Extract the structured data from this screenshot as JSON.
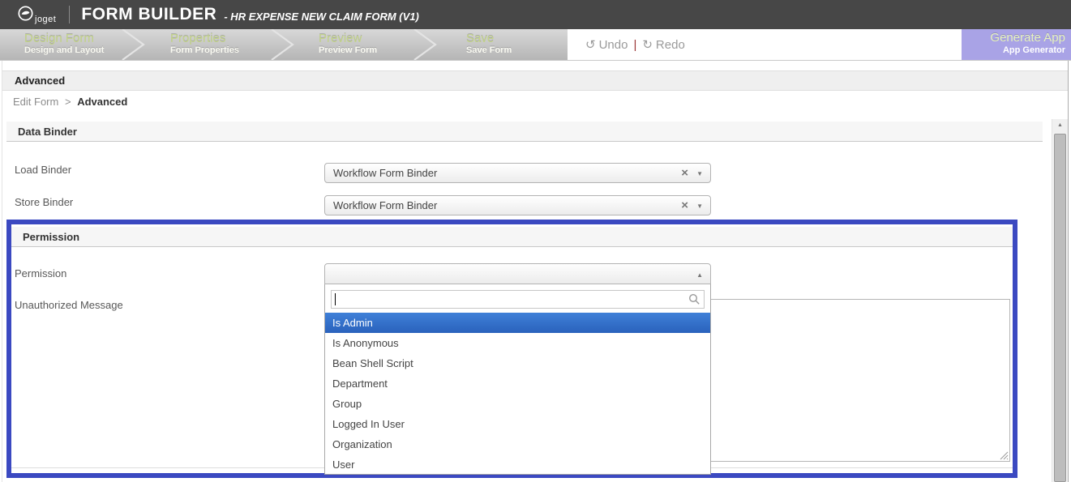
{
  "header": {
    "logo": "joget",
    "title": "FORM BUILDER",
    "subtitle": "- HR EXPENSE NEW CLAIM FORM (V1)"
  },
  "nav": {
    "steps": [
      {
        "label": "Design Form",
        "sublabel": "Design and Layout"
      },
      {
        "label": "Properties",
        "sublabel": "Form Properties"
      },
      {
        "label": "Preview",
        "sublabel": "Preview Form"
      },
      {
        "label": "Save",
        "sublabel": "Save Form"
      }
    ],
    "undo_label": "Undo",
    "redo_label": "Redo",
    "divider": "|",
    "generate_app": {
      "label": "Generate App",
      "sublabel": "App Generator"
    }
  },
  "page": {
    "title": "Advanced",
    "breadcrumb": {
      "parent": "Edit Form",
      "separator": ">",
      "current": "Advanced"
    }
  },
  "data_binder": {
    "title": "Data Binder",
    "fields": [
      {
        "label": "Load Binder",
        "value": "Workflow Form Binder"
      },
      {
        "label": "Store Binder",
        "value": "Workflow Form Binder"
      }
    ]
  },
  "permission": {
    "title": "Permission",
    "fields": {
      "permission_label": "Permission",
      "unauthorized_label": "Unauthorized Message",
      "unauthorized_value": ""
    },
    "dropdown": {
      "search_value": "",
      "selected_option": "Is Admin",
      "options": [
        "Is Admin",
        "Is Anonymous",
        "Bean Shell Script",
        "Department",
        "Group",
        "Logged In User",
        "Organization",
        "User"
      ]
    }
  },
  "icons": {
    "clear": "×",
    "dropdown_down": "▼",
    "dropdown_up": "▲",
    "undo": "↺",
    "redo": "↻",
    "scroll_up": "▲"
  },
  "colors": {
    "topbar_gray": "#474747",
    "accent_purple": "#a9a3e6",
    "step_title_green": "#c3d489",
    "selected_blue": "#3875d7",
    "highlight_border_blue": "#3b49c1"
  }
}
